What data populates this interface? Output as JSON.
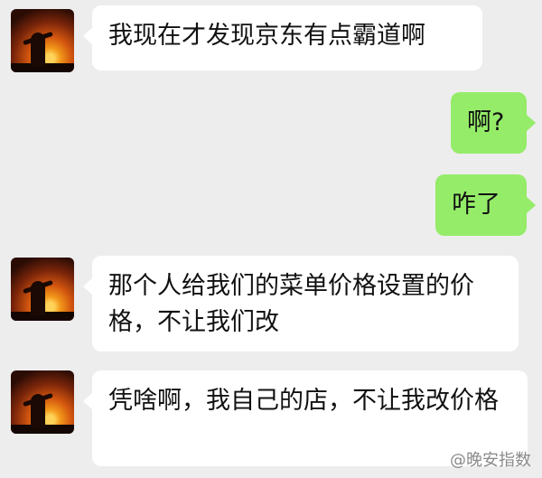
{
  "messages": [
    {
      "sender": "other",
      "text": "我现在才发现京东有点霸道啊"
    },
    {
      "sender": "self",
      "text": "啊?"
    },
    {
      "sender": "self",
      "text": "咋了"
    },
    {
      "sender": "other",
      "text": "那个人给我们的菜单价格设置的价格，不让我们改"
    },
    {
      "sender": "other",
      "text": "凭啥啊，我自己的店，不让我改价格"
    }
  ],
  "watermark": "@晚安指数"
}
